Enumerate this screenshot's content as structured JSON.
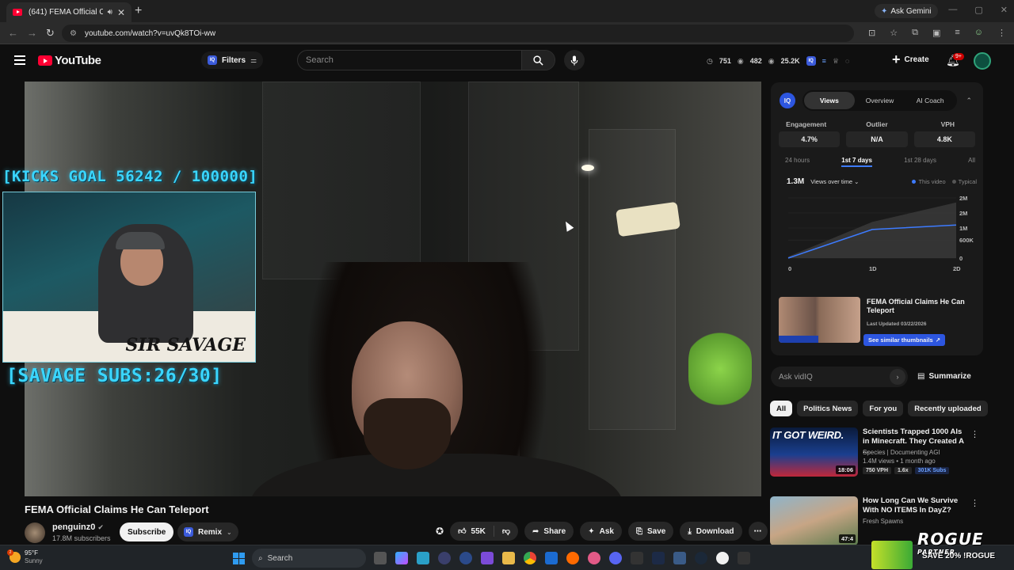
{
  "browser": {
    "tab_title": "(641) FEMA Official Claims",
    "url": "youtube.com/watch?v=uvQk8TOi-ww",
    "gemini_label": "Ask Gemini"
  },
  "youtube": {
    "logo": "YouTube",
    "filters_label": "Filters",
    "search_placeholder": "Search",
    "stats": [
      "751",
      "482",
      "25.2K"
    ],
    "create_label": "Create",
    "notif_badge": "9+"
  },
  "video": {
    "overlay_top": "[KICKS GOAL 56242 / 100000]",
    "overlay_bottom": "[SAVAGE SUBS:26/30]",
    "cam_name": "SIR SAVAGE",
    "title": "FEMA Official Claims He Can Teleport",
    "channel": "penguinz0",
    "subscribers": "17.8M subscribers",
    "subscribe_label": "Subscribe",
    "remix_label": "Remix",
    "likes": "55K",
    "share_label": "Share",
    "ask_label": "Ask",
    "save_label": "Save",
    "download_label": "Download"
  },
  "vidiq": {
    "logo": "IQ",
    "tabs": [
      "Views",
      "Overview",
      "AI Coach"
    ],
    "metrics": [
      {
        "label": "Engagement",
        "value": "4.7%"
      },
      {
        "label": "Outlier",
        "value": "N/A"
      },
      {
        "label": "VPH",
        "value": "4.8K"
      }
    ],
    "ranges": [
      "24 hours",
      "1st 7 days",
      "1st 28 days",
      "All"
    ],
    "total_views": "1.3M",
    "views_select": "Views over time",
    "legend_this": "This video",
    "legend_typical": "Typical",
    "card_title": "FEMA Official Claims He Can Teleport",
    "card_date": "Last Updated 03/22/2026",
    "similar_label": "See similar thumbnails",
    "ask_placeholder": "Ask vidIQ",
    "summarize_label": "Summarize",
    "colors": {
      "accent": "#3d7bff",
      "typical": "#3a3a3a"
    }
  },
  "chart_data": {
    "type": "area",
    "x": [
      "0",
      "1D",
      "2D"
    ],
    "x_values": [
      0,
      1,
      2
    ],
    "y_ticks": [
      "0",
      "600K",
      "1M",
      "2M",
      "2M"
    ],
    "ylim": [
      0,
      2000000
    ],
    "series": [
      {
        "name": "This video",
        "values": [
          0,
          950000,
          1100000
        ]
      },
      {
        "name": "Typical",
        "values": [
          50000,
          1200000,
          1850000
        ]
      }
    ]
  },
  "chips": [
    "All",
    "Politics News",
    "For you",
    "Recently uploaded"
  ],
  "recommendations": [
    {
      "title": "Scientists Trapped 1000 AIs in Minecraft. They Created A ...",
      "channel": "Species | Documenting AGI",
      "meta": "1.4M views • 1 month ago",
      "tags": [
        "750 VPH",
        "1.6x",
        "301K Subs"
      ],
      "duration": "18:06",
      "thumb_text": "IT GOT WEIRD."
    },
    {
      "title": "How Long Can We Survive With NO ITEMS In DayZ?",
      "channel": "Fresh Spawns",
      "meta": "",
      "tags": [],
      "duration": "47:4",
      "thumb_text": ""
    }
  ],
  "taskbar": {
    "temp": "95°F",
    "condition": "Sunny",
    "badge": "2",
    "search_placeholder": "Search",
    "promo_brand": "ROGUE",
    "promo_sub": "PARTNER",
    "promo_code": "SAVE 20% !ROGUE"
  }
}
